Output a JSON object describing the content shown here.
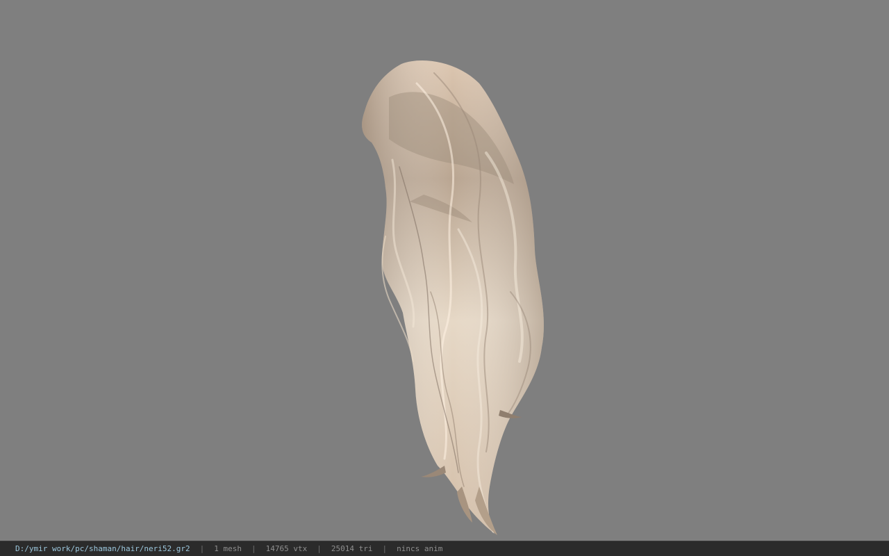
{
  "viewer": {
    "background_color": "#7f7f7f",
    "model_icon": "hair-mesh-icon",
    "hair_color_light": "#e6d8c4",
    "hair_color_mid": "#cbb8a1",
    "hair_color_dark": "#8f7e6e"
  },
  "status": {
    "path": "D:/ymir work/pc/shaman/hair/neri52.gr2",
    "separator": "|",
    "mesh": "1 mesh",
    "vtx": "14765 vtx",
    "tri": "25014 tri",
    "anim": "nincs anim"
  }
}
